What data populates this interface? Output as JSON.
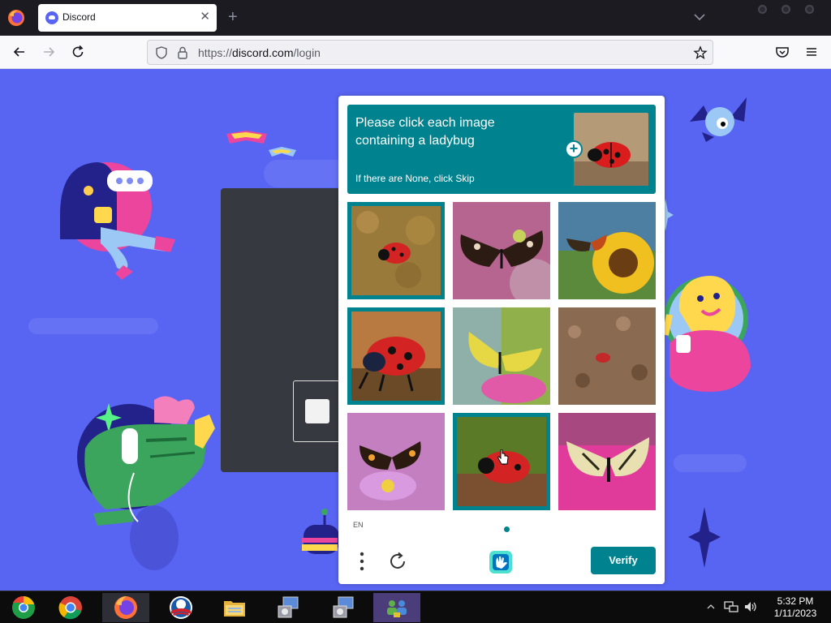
{
  "browser": {
    "tab_title": "Discord",
    "tab_close": "✕",
    "new_tab": "+",
    "url_prefix": "https://",
    "url_domain": "discord.com",
    "url_path": "/login"
  },
  "captcha": {
    "prompt_line1": "Please click each image",
    "prompt_line2": "containing a ladybug",
    "prompt_sub": "If there are None, click Skip",
    "language": "EN",
    "verify_label": "Verify",
    "tiles": [
      {
        "subject": "ladybug",
        "selected": true
      },
      {
        "subject": "butterfly",
        "selected": false
      },
      {
        "subject": "butterfly on sunflower",
        "selected": false
      },
      {
        "subject": "ladybug",
        "selected": true
      },
      {
        "subject": "butterfly",
        "selected": false
      },
      {
        "subject": "ladybug on soil",
        "selected": false
      },
      {
        "subject": "butterfly",
        "selected": false
      },
      {
        "subject": "ladybug",
        "selected": true
      },
      {
        "subject": "butterfly",
        "selected": false
      }
    ],
    "accent_color": "#00838f"
  },
  "page": {
    "background_color": "#5865f2"
  },
  "taskbar": {
    "apps": [
      "chrome-icon",
      "chrome-icon",
      "firefox-icon",
      "obama-logo-icon",
      "file-explorer-icon",
      "installer-icon",
      "installer-icon",
      "network-people-icon"
    ],
    "time": "5:32 PM",
    "date": "1/11/2023"
  }
}
